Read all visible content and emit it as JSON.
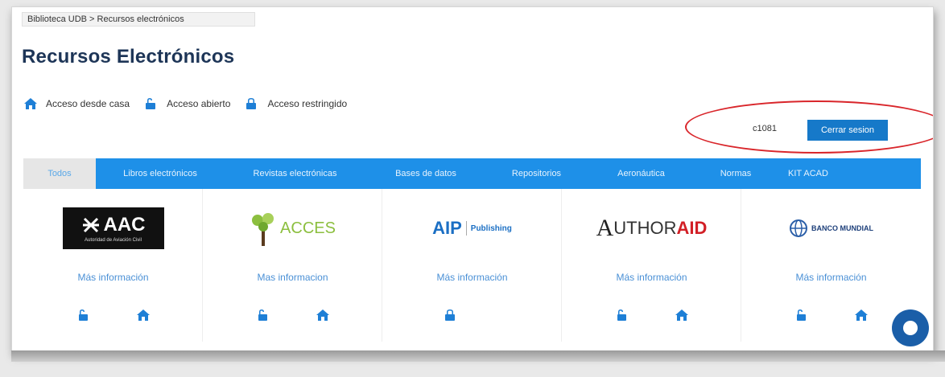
{
  "breadcrumb": "Biblioteca UDB > Recursos electrónicos",
  "title": "Recursos Electrónicos",
  "legend": [
    {
      "label": "Acceso desde casa",
      "icon": "home-icon"
    },
    {
      "label": "Acceso abierto",
      "icon": "unlock-icon"
    },
    {
      "label": "Acceso restringido",
      "icon": "lock-icon"
    }
  ],
  "user": {
    "code": "c1081",
    "logout_label": "Cerrar sesion"
  },
  "tabs": [
    {
      "label": "Todos",
      "active": true
    },
    {
      "label": "Libros electrónicos"
    },
    {
      "label": "Revistas electrónicas"
    },
    {
      "label": "Bases de datos"
    },
    {
      "label": "Repositorios"
    },
    {
      "label": "Aeronáutica"
    },
    {
      "label": "Normas"
    },
    {
      "label": "KIT ACAD"
    }
  ],
  "resources": [
    {
      "name": "AAC",
      "subtitle": "Autoridad de Aviación Civil",
      "more": "Más información",
      "access": [
        "unlock-icon",
        "home-icon"
      ]
    },
    {
      "name": "ACCES",
      "more": "Mas informacion",
      "access": [
        "unlock-icon",
        "home-icon"
      ]
    },
    {
      "name": "AIP",
      "tag": "Publishing",
      "more": "Más información",
      "access": [
        "lock-icon"
      ]
    },
    {
      "name_a": "A",
      "name_b": "UTHOR",
      "name_c": "AID",
      "more": "Más información",
      "access": [
        "unlock-icon",
        "home-icon"
      ]
    },
    {
      "name": "BANCO MUNDIAL",
      "more": "Más información",
      "access": [
        "unlock-icon",
        "home-icon"
      ]
    }
  ],
  "colors": {
    "accent": "#1e90e8",
    "title": "#1d3557",
    "link": "#4a90d6",
    "highlight": "#d9262b"
  }
}
